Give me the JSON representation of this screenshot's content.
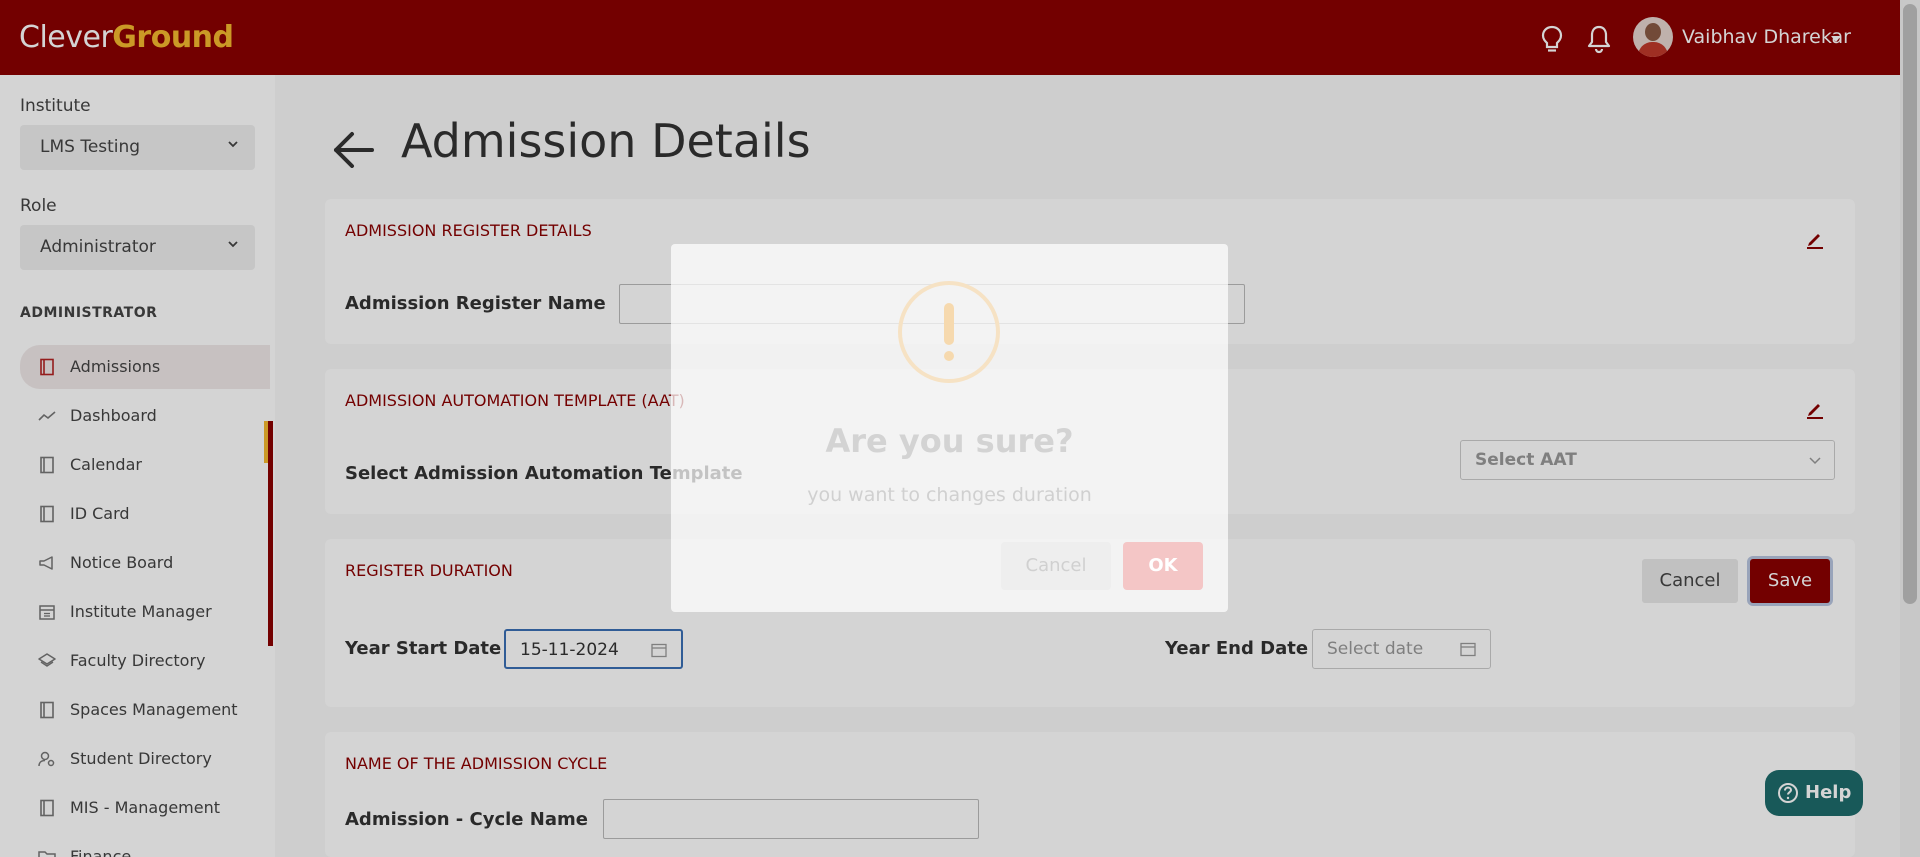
{
  "header": {
    "logo_part1": "Clever",
    "logo_part2": "Ground",
    "username": "Vaibhav Dharekar",
    "icons": [
      "lightbulb-icon",
      "bell-icon"
    ],
    "brand_color": "#8b0000",
    "accent_color": "#f5b82e"
  },
  "sidebar": {
    "institute_label": "Institute",
    "institute_value": "LMS Testing",
    "role_label": "Role",
    "role_value": "Administrator",
    "section_heading": "ADMINISTRATOR",
    "items": [
      {
        "label": "Admissions",
        "icon": "book-icon",
        "active": true
      },
      {
        "label": "Dashboard",
        "icon": "trend-icon"
      },
      {
        "label": "Calendar",
        "icon": "book-icon"
      },
      {
        "label": "ID Card",
        "icon": "book-icon"
      },
      {
        "label": "Notice Board",
        "icon": "megaphone-icon"
      },
      {
        "label": "Institute Manager",
        "icon": "calendar-grid-icon"
      },
      {
        "label": "Faculty Directory",
        "icon": "layers-icon"
      },
      {
        "label": "Spaces Management",
        "icon": "book-icon"
      },
      {
        "label": "Student Directory",
        "icon": "user-search-icon"
      },
      {
        "label": "MIS - Management",
        "icon": "book-icon"
      },
      {
        "label": "Finance",
        "icon": "folder-icon"
      }
    ]
  },
  "main": {
    "page_title": "Admission Details",
    "register": {
      "title": "ADMISSION REGISTER DETAILS",
      "field_label": "Admission Register Name",
      "field_value": ""
    },
    "aat": {
      "title": "ADMISSION AUTOMATION TEMPLATE (AAT)",
      "field_label": "Select Admission Automation Template",
      "select_value": "Select AAT"
    },
    "duration": {
      "title": "REGISTER DURATION",
      "start_label": "Year Start Date",
      "start_value": "15-11-2024",
      "end_label": "Year End Date",
      "end_placeholder": "Select date",
      "cancel_label": "Cancel",
      "save_label": "Save"
    },
    "cycle": {
      "title": "NAME OF THE ADMISSION CYCLE",
      "field_label": "Admission - Cycle Name",
      "field_value": ""
    }
  },
  "help": {
    "label": "Help"
  },
  "modal": {
    "title": "Are you sure?",
    "text": "you want to changes duration",
    "cancel_label": "Cancel",
    "ok_label": "OK"
  }
}
